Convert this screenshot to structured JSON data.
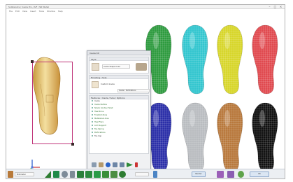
{
  "window": {
    "title": "Solidworks / Insole Pro / AIF / SR Model",
    "minimize": "–",
    "maximize": "□",
    "close": "×"
  },
  "menu": [
    "File",
    "Edit",
    "View",
    "Insert",
    "Tools",
    "Window",
    "Help"
  ],
  "panel": {
    "title": "Insole Kit",
    "section_style": "Style",
    "style_value": "Insole Shape Color",
    "section_finishing": "Finishing / Sole",
    "finishing_value": "Custom Insole",
    "finishing_sub": "Insole • Perforations",
    "section_tree": "Features / Insole / Sole / Options",
    "tree": [
      "Insole",
      "Insole Outline",
      "Shank Contour Shell",
      "Heel Zone",
      "Forefoot Zone",
      "Metatarsal Area",
      "Heel Flare",
      "Arch Support",
      "Toe Spring",
      "Perforations",
      "Toe Cap"
    ]
  },
  "statusbar": {
    "units": "Millimeter",
    "btn_left": "Render",
    "btn_right": "OK"
  },
  "colors": {
    "accent": "#2e7d32",
    "insole_palette": [
      "#2e9b3f",
      "#32c6cf",
      "#d7d62a",
      "#e04a4f",
      "#2b2fa8",
      "#b9bcc0",
      "#b8783c",
      "#111111"
    ],
    "selected_insole": "#d2a64e",
    "selection_frame": "#c0357a"
  }
}
